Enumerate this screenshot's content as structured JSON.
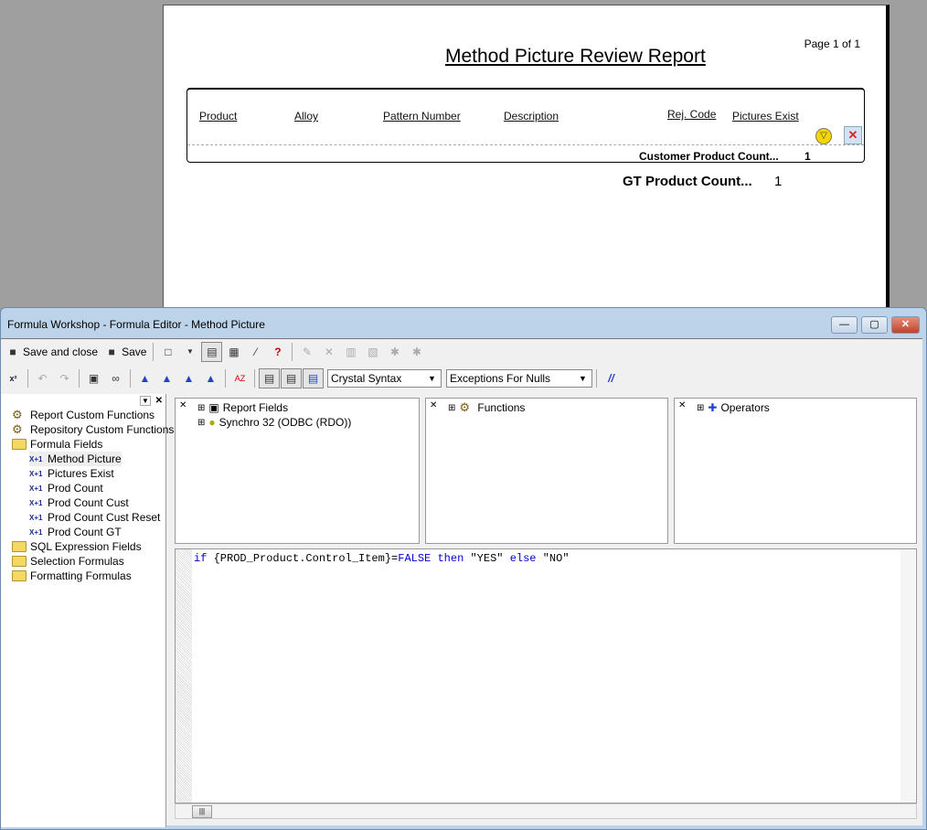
{
  "report": {
    "title": "Method Picture Review Report",
    "page": "Page 1 of 1",
    "columns": [
      "Product",
      "Alloy",
      "Pattern Number",
      "Description",
      "Rej. Code",
      "Pictures Exist"
    ],
    "customer_count_label": "Customer Product Count...",
    "customer_count": "1",
    "gt_count_label": "GT Product Count...",
    "gt_count": "1"
  },
  "window": {
    "title": "Formula Workshop - Formula Editor - Method Picture",
    "min": "—",
    "max": "▢",
    "close": "✕"
  },
  "toolbar1": {
    "save_close": "Save and close",
    "save": "Save"
  },
  "toolbar2": {
    "syntax": "Crystal Syntax",
    "nulls": "Exceptions For Nulls",
    "comment": "//"
  },
  "tree": [
    {
      "label": "Report Custom Functions",
      "icon": "gear"
    },
    {
      "label": "Repository Custom Functions",
      "icon": "gear"
    },
    {
      "label": "Formula Fields",
      "icon": "folder"
    },
    {
      "label": "Method Picture",
      "icon": "formula"
    },
    {
      "label": "Pictures Exist",
      "icon": "formula"
    },
    {
      "label": "Prod Count",
      "icon": "formula"
    },
    {
      "label": "Prod Count Cust",
      "icon": "formula"
    },
    {
      "label": "Prod Count Cust Reset",
      "icon": "formula"
    },
    {
      "label": "Prod Count GT",
      "icon": "formula"
    },
    {
      "label": "SQL Expression Fields",
      "icon": "folder"
    },
    {
      "label": "Selection Formulas",
      "icon": "folder"
    },
    {
      "label": "Formatting Formulas",
      "icon": "folder"
    }
  ],
  "panes": {
    "fields": [
      "Report Fields",
      "Synchro 32 (ODBC (RDO))"
    ],
    "functions": "Functions",
    "operators": "Operators"
  },
  "code": {
    "k1": "if",
    " t1": "",
    "t1": " {PROD_Product.Control_Item}=",
    "k2": "FALSE",
    "k3": " then",
    "t2": " \"YES\"",
    "k4": " else",
    "t3": " \"NO\""
  },
  "colors": {
    "keyword": "#0000cc",
    "titlebar": "#bcd3ea"
  }
}
